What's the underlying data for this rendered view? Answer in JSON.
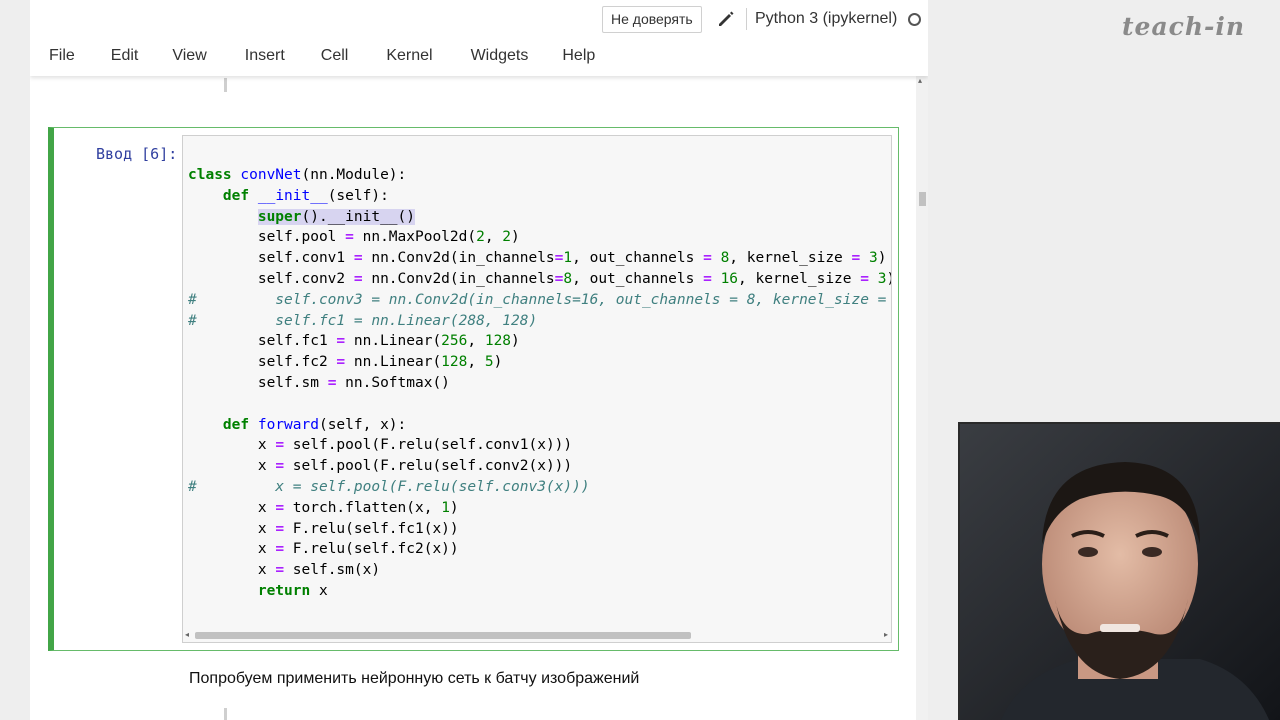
{
  "header": {
    "trust_button": "Не доверять",
    "kernel_name": "Python 3 (ipykernel)"
  },
  "menu": [
    "File",
    "Edit",
    "View",
    "Insert",
    "Cell",
    "Kernel",
    "Widgets",
    "Help"
  ],
  "cell": {
    "prompt": "Ввод [6]:"
  },
  "markdown_text": "Попробуем применить нейронную сеть к батчу изображений",
  "watermark": "teach-in",
  "colors": {
    "cell_border": "#42a547",
    "prompt": "#303f9f",
    "keyword": "#008000",
    "comment": "#408080"
  }
}
